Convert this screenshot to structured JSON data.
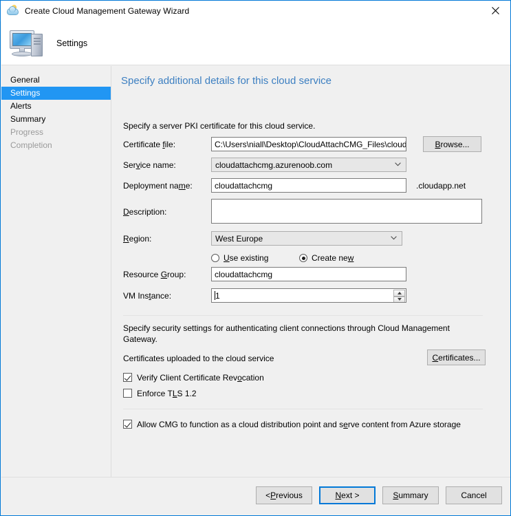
{
  "window": {
    "title": "Create Cloud Management Gateway Wizard",
    "title_icon": "cloud-sun-icon",
    "close_label": "✕"
  },
  "header": {
    "icon": "computer-icon",
    "title": "Settings"
  },
  "sidebar": {
    "items": [
      {
        "label": "General",
        "state": "normal"
      },
      {
        "label": "Settings",
        "state": "selected"
      },
      {
        "label": "Alerts",
        "state": "normal"
      },
      {
        "label": "Summary",
        "state": "normal"
      },
      {
        "label": "Progress",
        "state": "disabled"
      },
      {
        "label": "Completion",
        "state": "disabled"
      }
    ]
  },
  "main": {
    "page_title": "Specify additional details for this cloud service",
    "intro_text": "Specify a server PKI certificate for this cloud service.",
    "fields": {
      "certificate_file": {
        "label_pre": "Certificate ",
        "label_accel": "f",
        "label_post": "ile:",
        "value": "C:\\Users\\niall\\Desktop\\CloudAttachCMG_Files\\clouda",
        "browse_pre": "",
        "browse_accel": "B",
        "browse_post": "rowse..."
      },
      "service_name": {
        "label_pre": "Ser",
        "label_accel": "v",
        "label_post": "ice name:",
        "value": "cloudattachcmg.azurenoob.com"
      },
      "deployment_name": {
        "label_pre": "Deployment na",
        "label_accel": "m",
        "label_post": "e:",
        "value": "cloudattachcmg",
        "suffix": ".cloudapp.net"
      },
      "description": {
        "label_pre": "",
        "label_accel": "D",
        "label_post": "escription:",
        "value": ""
      },
      "region": {
        "label_pre": "",
        "label_accel": "R",
        "label_post": "egion:",
        "value": "West Europe"
      },
      "resource_group_mode": {
        "use_existing_pre": "",
        "use_existing_accel": "U",
        "use_existing_post": "se existing",
        "use_existing_selected": false,
        "create_new_pre": "Create ne",
        "create_new_accel": "w",
        "create_new_post": "",
        "create_new_selected": true
      },
      "resource_group": {
        "label_pre": "Resource ",
        "label_accel": "G",
        "label_post": "roup:",
        "value": "cloudattachcmg"
      },
      "vm_instance": {
        "label_pre": "VM Ins",
        "label_accel": "t",
        "label_post": "ance:",
        "value": "1"
      }
    },
    "security": {
      "description": "Specify security settings for authenticating client connections through Cloud Management Gateway.",
      "certificates_uploaded_label": "Certificates uploaded to the cloud service",
      "certificates_button_pre": "",
      "certificates_button_accel": "C",
      "certificates_button_post": "ertificates...",
      "verify_revocation": {
        "pre": "Verify Client Certificate Rev",
        "accel": "o",
        "post": "cation",
        "checked": true
      },
      "enforce_tls": {
        "pre": "Enforce T",
        "accel": "L",
        "post": "S 1.2",
        "checked": false
      }
    },
    "distribution_point": {
      "pre": "Allow CMG to function as a cloud distribution point and s",
      "accel": "e",
      "post": "rve content from Azure storage",
      "checked": true
    }
  },
  "footer": {
    "previous_pre": "< ",
    "previous_accel": "P",
    "previous_post": "revious",
    "next_pre": "",
    "next_accel": "N",
    "next_post": "ext >",
    "summary_pre": "",
    "summary_accel": "S",
    "summary_post": "ummary",
    "cancel_label": "Cancel"
  },
  "colors": {
    "accent": "#0078d7",
    "title_blue": "#3c7fc1",
    "selection": "#2196f3",
    "panel": "#f0f0f0"
  }
}
